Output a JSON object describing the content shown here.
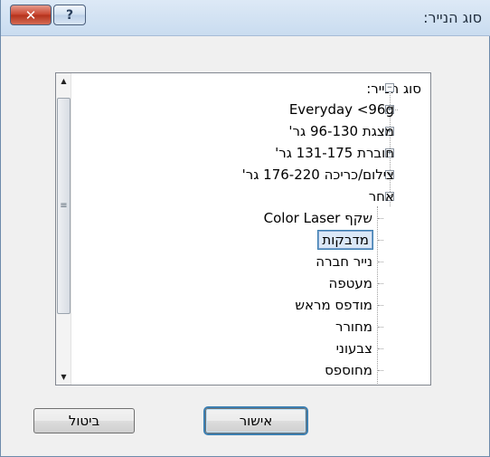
{
  "window": {
    "title": "סוג הנייר:",
    "close_glyph": "✕",
    "help_glyph": "?"
  },
  "tree": {
    "root_label": "סוג הנייר:",
    "items": [
      {
        "label": "Everyday <96g",
        "expander": "+"
      },
      {
        "label": "מצגת 96-130 גר'",
        "expander": "+"
      },
      {
        "label": "חוברת 131-175 גר'",
        "expander": "+"
      },
      {
        "label": "צילום/כריכה 176-220 גר'",
        "expander": "+"
      },
      {
        "label": "אחר",
        "expander": "−"
      }
    ],
    "other_children": [
      "שקף Color Laser",
      "מדבקות",
      "נייר חברה",
      "מעטפה",
      "מודפס מראש",
      "מחורר",
      "צבעוני",
      "מחוספס"
    ],
    "selected_item": "מדבקות",
    "root_expander": "−"
  },
  "buttons": {
    "ok": "אישור",
    "cancel": "ביטול"
  },
  "colors": {
    "selection_border": "#3c7fb1",
    "selection_fill": "#dbe8f7",
    "close_button": "#c8432d"
  }
}
